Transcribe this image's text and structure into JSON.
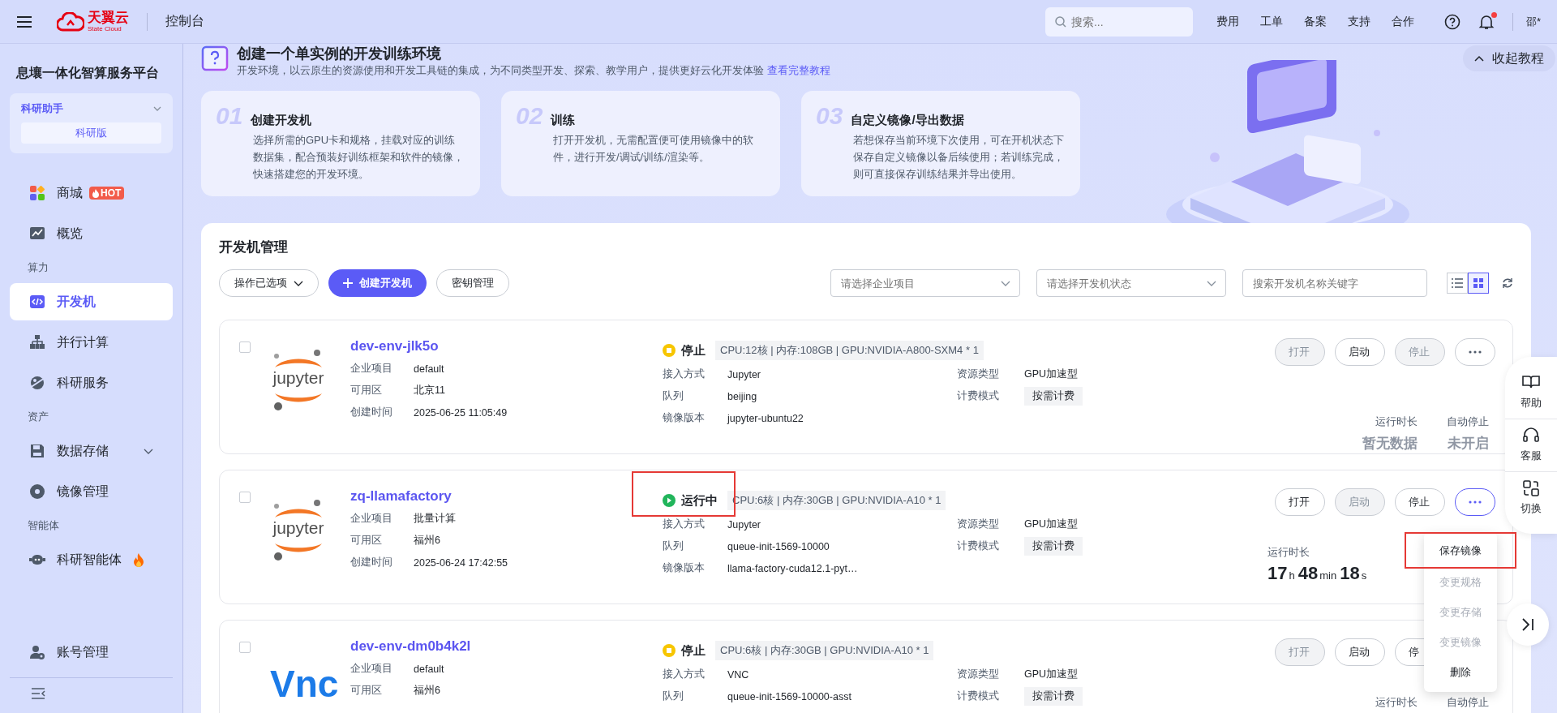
{
  "topbar": {
    "brand": "天翼云",
    "brand_sub": "State Cloud",
    "console": "控制台",
    "search": {
      "placeholder": "搜索..."
    },
    "links": [
      "费用",
      "工单",
      "备案",
      "支持",
      "合作"
    ],
    "notification_dot": true,
    "user": "邵*"
  },
  "sidebar": {
    "title": "息壤一体化智算服务平台",
    "workspace": {
      "name": "科研助手",
      "edition": "科研版"
    },
    "items": [
      {
        "kind": "item",
        "label": "商城",
        "badge": "HOT",
        "selected": false
      },
      {
        "kind": "item",
        "label": "概览",
        "selected": false
      },
      {
        "kind": "section",
        "label": "算力"
      },
      {
        "kind": "item",
        "label": "开发机",
        "selected": true
      },
      {
        "kind": "item",
        "label": "并行计算",
        "selected": false
      },
      {
        "kind": "item",
        "label": "科研服务",
        "selected": false
      },
      {
        "kind": "section",
        "label": "资产"
      },
      {
        "kind": "group",
        "label": "数据存储",
        "selected": false,
        "expanded": false
      },
      {
        "kind": "item",
        "label": "镜像管理",
        "selected": false
      },
      {
        "kind": "section",
        "label": "智能体"
      },
      {
        "kind": "item",
        "label": "科研智能体",
        "flame": true,
        "selected": false
      },
      {
        "kind": "spacer"
      },
      {
        "kind": "item",
        "label": "账号管理",
        "selected": false
      }
    ]
  },
  "tutorial": {
    "title": "创建一个单实例的开发训练环境",
    "description": "开发环境，以云原生的资源使用和开发工具链的集成，为不同类型开发、探索、教学用户，提供更好云化开发体验",
    "link": "查看完整教程",
    "collapse": "收起教程",
    "steps": [
      {
        "number": "01",
        "title": "创建开发机",
        "text": "选择所需的GPU卡和规格，挂载对应的训练数据集，配合预装好训练框架和软件的镜像，快速搭建您的开发环境。"
      },
      {
        "number": "02",
        "title": "训练",
        "text": "打开开发机，无需配置便可使用镜像中的软件，进行开发/调试/训练/渲染等。"
      },
      {
        "number": "03",
        "title": "自定义镜像/导出数据",
        "text": "若想保存当前环境下次使用，可在开机状态下保存自定义镜像以备后续使用；若训练完成，则可直接保存训练结果并导出使用。"
      }
    ]
  },
  "panel": {
    "title": "开发机管理",
    "bulk": "操作已选项",
    "create": "创建开发机",
    "keys": "密钥管理",
    "filters": [
      {
        "placeholder": "请选择企业项目"
      },
      {
        "placeholder": "请选择开发机状态"
      }
    ],
    "search": {
      "placeholder": "搜索开发机名称关键字"
    },
    "views": [
      {
        "kind": "list",
        "selected": false
      },
      {
        "kind": "grid",
        "selected": true
      }
    ]
  },
  "instances": [
    {
      "name": "dev-env-jlk5o",
      "logo": {
        "kind": "jupyter",
        "text": "jupyter"
      },
      "checked": false,
      "highlighted": false,
      "status": {
        "kind": "stopped",
        "label": "停止"
      },
      "spec": "CPU:12核 | 内存:108GB | GPU:NVIDIA-A800-SXM4 * 1",
      "info": [
        {
          "label": "企业项目",
          "value": "default"
        },
        {
          "label": "可用区",
          "value": "北京11"
        },
        {
          "label": "创建时间",
          "value": "2025-06-25 11:05:49"
        }
      ],
      "access": [
        {
          "label": "接入方式",
          "value": "Jupyter"
        },
        {
          "label": "队列",
          "value": "beijing"
        },
        {
          "label": "镜像版本",
          "value": "jupyter-ubuntu22"
        }
      ],
      "resource": [
        {
          "label": "资源类型",
          "value": "GPU加速型",
          "tag": false
        },
        {
          "label": "计费模式",
          "value": "按需计费",
          "tag": true
        }
      ],
      "actions": [
        {
          "label": "打开",
          "disabled": true
        },
        {
          "label": "启动",
          "disabled": false
        },
        {
          "label": "停止",
          "disabled": true
        }
      ],
      "more": {
        "active": false
      },
      "stats": [
        {
          "label": "运行时长",
          "value": "暂无数据"
        },
        {
          "label": "自动停止",
          "value": "未开启"
        }
      ]
    },
    {
      "name": "zq-llamafactory",
      "logo": {
        "kind": "jupyter",
        "text": "jupyter"
      },
      "checked": false,
      "highlighted": true,
      "status": {
        "kind": "running",
        "label": "运行中"
      },
      "spec": "CPU:6核 | 内存:30GB | GPU:NVIDIA-A10 * 1",
      "info": [
        {
          "label": "企业项目",
          "value": "批量计算"
        },
        {
          "label": "可用区",
          "value": "福州6"
        },
        {
          "label": "创建时间",
          "value": "2025-06-24 17:42:55"
        }
      ],
      "access": [
        {
          "label": "接入方式",
          "value": "Jupyter"
        },
        {
          "label": "队列",
          "value": "queue-init-1569-10000"
        },
        {
          "label": "镜像版本",
          "value": "llama-factory-cuda12.1-pyt…"
        }
      ],
      "resource": [
        {
          "label": "资源类型",
          "value": "GPU加速型",
          "tag": false
        },
        {
          "label": "计费模式",
          "value": "按需计费",
          "tag": true
        }
      ],
      "actions": [
        {
          "label": "打开",
          "disabled": false
        },
        {
          "label": "启动",
          "disabled": true
        },
        {
          "label": "停止",
          "disabled": false
        }
      ],
      "more": {
        "active": true
      },
      "duration": {
        "label": "运行时长",
        "parts": [
          {
            "value": "17",
            "unit": "h"
          },
          {
            "value": "48",
            "unit": "min"
          },
          {
            "value": "18",
            "unit": "s"
          }
        ]
      },
      "menu": [
        {
          "label": "保存镜像",
          "disabled": false,
          "highlighted": true
        },
        {
          "label": "变更规格",
          "disabled": true,
          "highlighted": false
        },
        {
          "label": "变更存储",
          "disabled": true,
          "highlighted": false
        },
        {
          "label": "变更镜像",
          "disabled": true,
          "highlighted": false
        },
        {
          "label": "删除",
          "disabled": false,
          "highlighted": false
        }
      ]
    },
    {
      "name": "dev-env-dm0b4k2l",
      "logo": {
        "kind": "vnc",
        "text": "Vnc"
      },
      "checked": false,
      "highlighted": false,
      "status": {
        "kind": "stopped",
        "label": "停止"
      },
      "spec": "CPU:6核 | 内存:30GB | GPU:NVIDIA-A10 * 1",
      "info": [
        {
          "label": "企业项目",
          "value": "default"
        },
        {
          "label": "可用区",
          "value": "福州6"
        }
      ],
      "access": [
        {
          "label": "接入方式",
          "value": "VNC"
        },
        {
          "label": "队列",
          "value": "queue-init-1569-10000-asst"
        }
      ],
      "resource": [
        {
          "label": "资源类型",
          "value": "GPU加速型",
          "tag": false
        },
        {
          "label": "计费模式",
          "value": "按需计费",
          "tag": true
        }
      ],
      "actions": [
        {
          "label": "打开",
          "disabled": true
        },
        {
          "label": "启动",
          "disabled": false
        },
        {
          "label": "停",
          "disabled": false
        }
      ],
      "stats": [
        {
          "label": "运行时长"
        },
        {
          "label": "自动停止"
        }
      ]
    }
  ],
  "float_tools": [
    {
      "kind": "book",
      "label": "帮助"
    },
    {
      "kind": "headset",
      "label": "客服"
    },
    {
      "kind": "switch",
      "label": "切换"
    }
  ]
}
